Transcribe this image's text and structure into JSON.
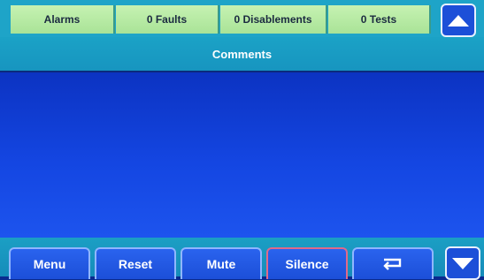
{
  "status_bar": {
    "alarms": "Alarms",
    "faults": "0 Faults",
    "disablements": "0 Disablements",
    "tests": "0 Tests"
  },
  "header": {
    "title": "Comments"
  },
  "buttons": {
    "menu": "Menu",
    "reset": "Reset",
    "mute": "Mute",
    "silence": "Silence"
  },
  "icons": {
    "up": "arrow-up-icon",
    "down": "arrow-down-icon",
    "enter": "enter-return-icon"
  },
  "colors": {
    "status_tile": "#b6e9a3",
    "bar_cyan": "#1ba2c6",
    "content_blue": "#1446e2",
    "silence_border": "#e06a8a"
  }
}
